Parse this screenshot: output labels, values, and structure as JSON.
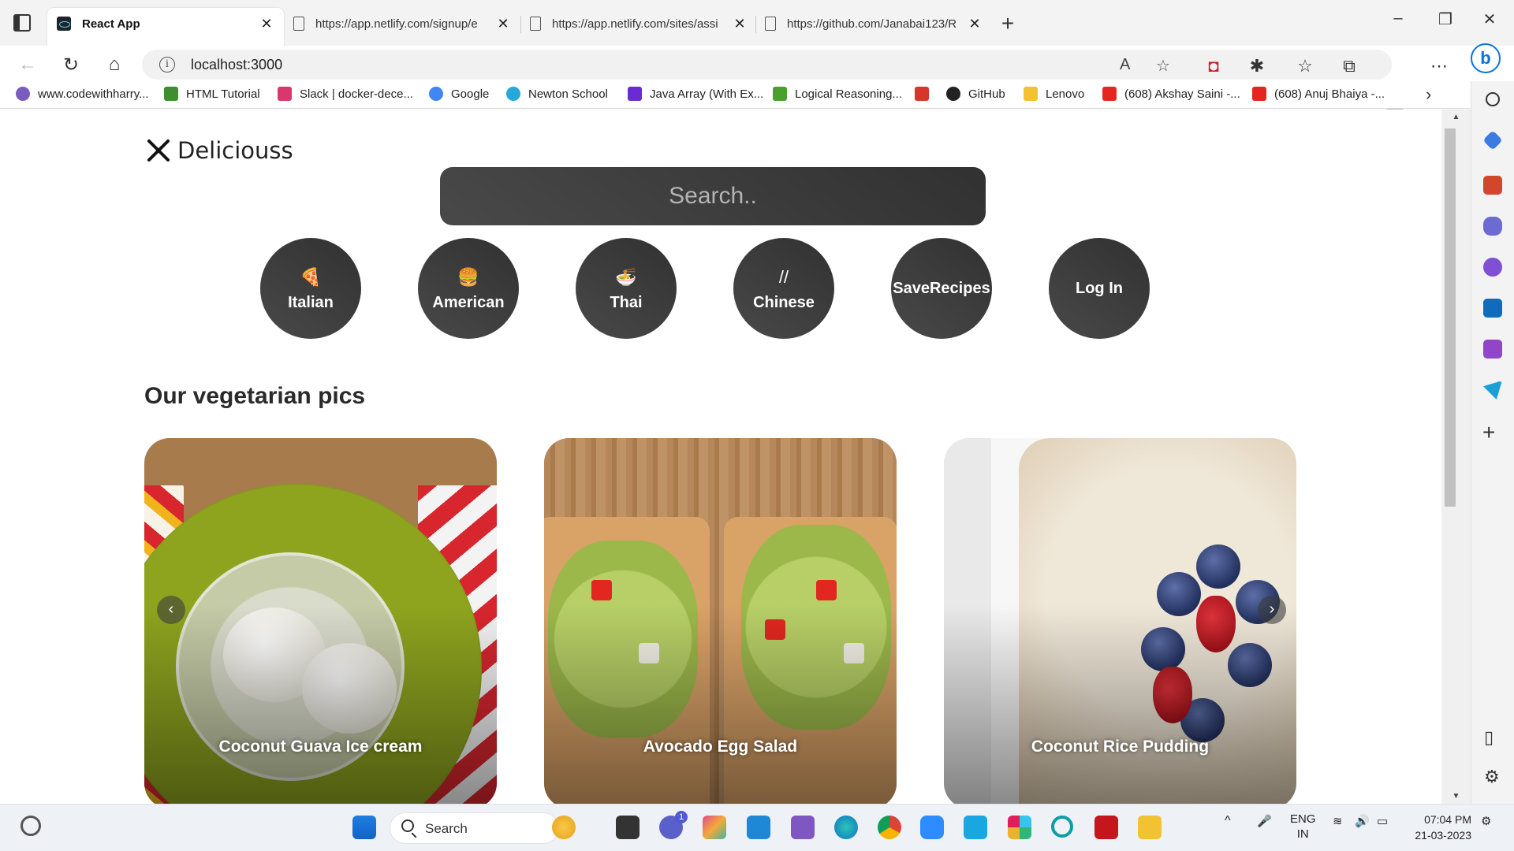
{
  "browser": {
    "tabs": [
      {
        "title": "React App",
        "active": true
      },
      {
        "title": "https://app.netlify.com/signup/e",
        "active": false
      },
      {
        "title": "https://app.netlify.com/sites/assi",
        "active": false
      },
      {
        "title": "https://github.com/Janabai123/R",
        "active": false
      }
    ],
    "address": "localhost:3000",
    "bookmarks": [
      {
        "label": "www.codewithharry...",
        "color": "#7a5cbe"
      },
      {
        "label": "HTML Tutorial",
        "color": "#3e8e2f"
      },
      {
        "label": "Slack | docker-dece...",
        "color": "#d9386e"
      },
      {
        "label": "Google",
        "color": "#4285f4"
      },
      {
        "label": "Newton School",
        "color": "#26a8d8"
      },
      {
        "label": "Java Array (With Ex...",
        "color": "#6b2bd3"
      },
      {
        "label": "Logical Reasoning...",
        "color": "#4aa02c"
      },
      {
        "label": "",
        "color": "#d6362b"
      },
      {
        "label": "GitHub",
        "color": "#222222"
      },
      {
        "label": "Lenovo",
        "color": "#f2c230"
      },
      {
        "label": "(608) Akshay Saini -...",
        "color": "#e52620"
      },
      {
        "label": "(608) Anuj Bhaiya -...",
        "color": "#e52620"
      }
    ]
  },
  "app": {
    "logo": "Deliciouss",
    "search_placeholder": "Search..",
    "categories": [
      {
        "label": "Italian",
        "icon": "🍕"
      },
      {
        "label": "American",
        "icon": "🍔"
      },
      {
        "label": "Thai",
        "icon": "🍜"
      },
      {
        "label": "Chinese",
        "icon": "//"
      },
      {
        "label": "SaveRecipes",
        "icon": ""
      },
      {
        "label": "Log In",
        "icon": ""
      }
    ],
    "section_title": "Our vegetarian pics",
    "recipes": [
      {
        "title": "Coconut Guava Ice cream"
      },
      {
        "title": "Avocado Egg Salad"
      },
      {
        "title": "Coconut Rice Pudding"
      }
    ]
  },
  "taskbar": {
    "search": "Search",
    "notify_count": "1",
    "lang_top": "ENG",
    "lang_bottom": "IN",
    "time": "07:04 PM",
    "date": "21-03-2023"
  }
}
